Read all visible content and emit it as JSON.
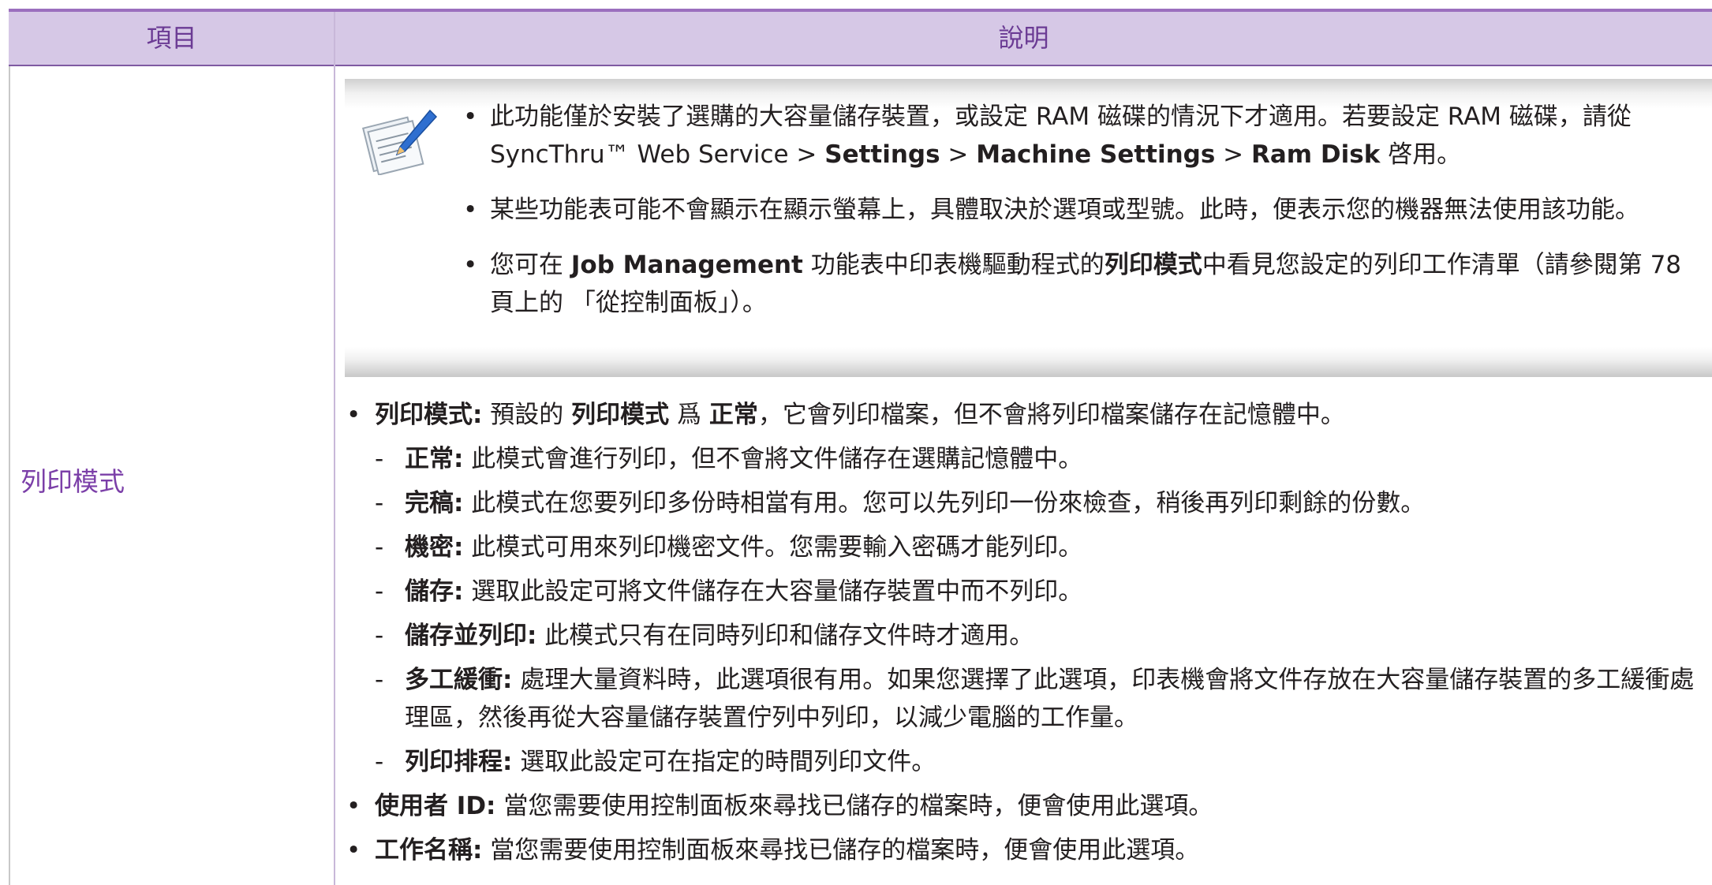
{
  "table": {
    "header": {
      "item": "項目",
      "description": "說明"
    },
    "row_label": "列印模式"
  },
  "note": {
    "icon": "note-pencil-icon",
    "bullet1": {
      "t1": "此功能僅於安裝了選購的大容量儲存裝置，或設定 RAM 磁碟的情況下才適用。若要設定 RAM 磁碟，請從 SyncThru™ Web Service > ",
      "b1": "Settings",
      "t2": " > ",
      "b2": "Machine Settings",
      "t3": " > ",
      "b3": "Ram Disk",
      "t4": " 啓用。"
    },
    "bullet2": {
      "t1": "某些功能表可能不會顯示在顯示螢幕上，具體取決於選項或型號。此時，便表示您的機器無法使用該功能。"
    },
    "bullet3": {
      "t1": "您可在 ",
      "b1": "Job Management",
      "t2": " 功能表中印表機驅動程式的",
      "b2": "列印模式",
      "t3": "中看見您設定的列印工作清單（請參閱第 78 頁上的 「從控制面板」）。"
    }
  },
  "content": {
    "print_mode": {
      "label": "列印模式:",
      "t1": " 預設的 ",
      "b1": "列印模式",
      "t2": " 爲 ",
      "b2": "正常",
      "t3": "，它會列印檔案，但不會將列印檔案儲存在記憶體中。"
    },
    "modes": [
      {
        "label": "正常:",
        "text": " 此模式會進行列印，但不會將文件儲存在選購記憶體中。"
      },
      {
        "label": "完稿:",
        "text": " 此模式在您要列印多份時相當有用。您可以先列印一份來檢查，稍後再列印剩餘的份數。"
      },
      {
        "label": "機密:",
        "text": " 此模式可用來列印機密文件。您需要輸入密碼才能列印。"
      },
      {
        "label": "儲存:",
        "text": " 選取此設定可將文件儲存在大容量儲存裝置中而不列印。"
      },
      {
        "label": "儲存並列印:",
        "text": " 此模式只有在同時列印和儲存文件時才適用。"
      },
      {
        "label": "多工緩衝:",
        "text": " 處理大量資料時，此選項很有用。如果您選擇了此選項，印表機會將文件存放在大容量儲存裝置的多工緩衝處理區，然後再從大容量儲存裝置佇列中列印，以減少電腦的工作量。"
      },
      {
        "label": "列印排程:",
        "text": " 選取此設定可在指定的時間列印文件。"
      }
    ],
    "user_id": {
      "label": "使用者 ID:",
      "text": " 當您需要使用控制面板來尋找已儲存的檔案時，便會使用此選項。"
    },
    "job_name": {
      "label": "工作名稱:",
      "text": " 當您需要使用控制面板來尋找已儲存的檔案時，便會使用此選項。"
    }
  }
}
